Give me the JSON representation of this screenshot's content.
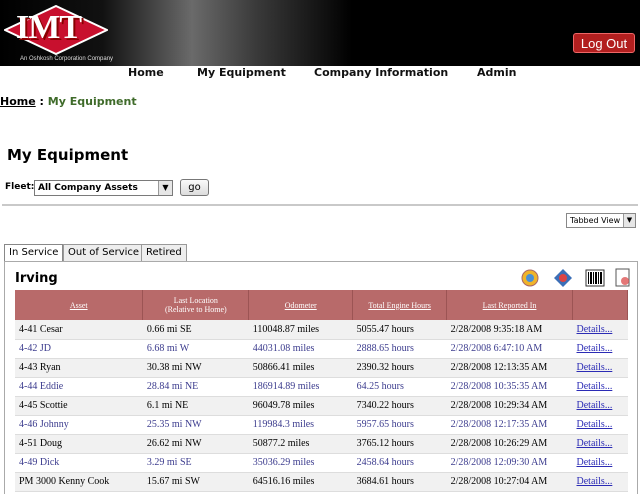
{
  "header": {
    "logo_text": "IMT",
    "logo_subtitle": "An Oshkosh Corporation Company",
    "logout_label": "Log Out"
  },
  "nav": {
    "items": [
      {
        "label": "Home"
      },
      {
        "label": "My Equipment"
      },
      {
        "label": "Company Information"
      },
      {
        "label": "Admin"
      }
    ]
  },
  "breadcrumb": {
    "home": "Home",
    "separator": ":",
    "current": "My Equipment"
  },
  "page": {
    "title": "My Equipment",
    "fleet_label": "Fleet:",
    "fleet_value": "All Company Assets",
    "go_label": "go",
    "view_value": "Tabbed View"
  },
  "tabs": [
    {
      "label": "In Service",
      "active": true
    },
    {
      "label": "Out of Service",
      "active": false
    },
    {
      "label": "Retired",
      "active": false
    }
  ],
  "panel": {
    "title": "Irving",
    "icons": [
      "globe-search-icon",
      "map-icon",
      "barcode-icon",
      "report-icon"
    ]
  },
  "table": {
    "headers": {
      "asset": "Asset",
      "last_location_line1": "Last Location",
      "last_location_line2": "(Relative to Home)",
      "odometer": "Odometer",
      "engine_hours": "Total Engine Hours",
      "last_reported": "Last Reported In"
    },
    "rows": [
      {
        "asset": "4-41 Cesar",
        "location": "0.66 mi SE",
        "odometer": "110048.87 miles",
        "hours": "5055.47 hours",
        "reported": "2/28/2008 9:35:18 AM",
        "details": "Details...",
        "blue": false
      },
      {
        "asset": "4-42 JD",
        "location": "6.68 mi W",
        "odometer": "44031.08 miles",
        "hours": "2888.65 hours",
        "reported": "2/28/2008 6:47:10 AM",
        "details": "Details...",
        "blue": true
      },
      {
        "asset": "4-43 Ryan",
        "location": "30.38 mi NW",
        "odometer": "50866.41 miles",
        "hours": "2390.32 hours",
        "reported": "2/28/2008 12:13:35 AM",
        "details": "Details...",
        "blue": false
      },
      {
        "asset": "4-44 Eddie",
        "location": "28.84 mi NE",
        "odometer": "186914.89 miles",
        "hours": "64.25 hours",
        "reported": "2/28/2008 10:35:35 AM",
        "details": "Details...",
        "blue": true
      },
      {
        "asset": "4-45 Scottie",
        "location": "6.1 mi NE",
        "odometer": "96049.78 miles",
        "hours": "7340.22 hours",
        "reported": "2/28/2008 10:29:34 AM",
        "details": "Details...",
        "blue": false
      },
      {
        "asset": "4-46 Johnny",
        "location": "25.35 mi NW",
        "odometer": "119984.3 miles",
        "hours": "5957.65 hours",
        "reported": "2/28/2008 12:17:35 AM",
        "details": "Details...",
        "blue": true
      },
      {
        "asset": "4-51 Doug",
        "location": "26.62 mi NW",
        "odometer": "50877.2 miles",
        "hours": "3765.12 hours",
        "reported": "2/28/2008 10:26:29 AM",
        "details": "Details...",
        "blue": false
      },
      {
        "asset": "4-49 Dick",
        "location": "3.29 mi SE",
        "odometer": "35036.29 miles",
        "hours": "2458.64 hours",
        "reported": "2/28/2008 12:09:30 AM",
        "details": "Details...",
        "blue": true
      },
      {
        "asset": "PM 3000 Kenny Cook",
        "location": "15.67 mi SW",
        "odometer": "64516.16 miles",
        "hours": "3684.61 hours",
        "reported": "2/28/2008 10:27:04 AM",
        "details": "Details...",
        "blue": false
      }
    ]
  }
}
